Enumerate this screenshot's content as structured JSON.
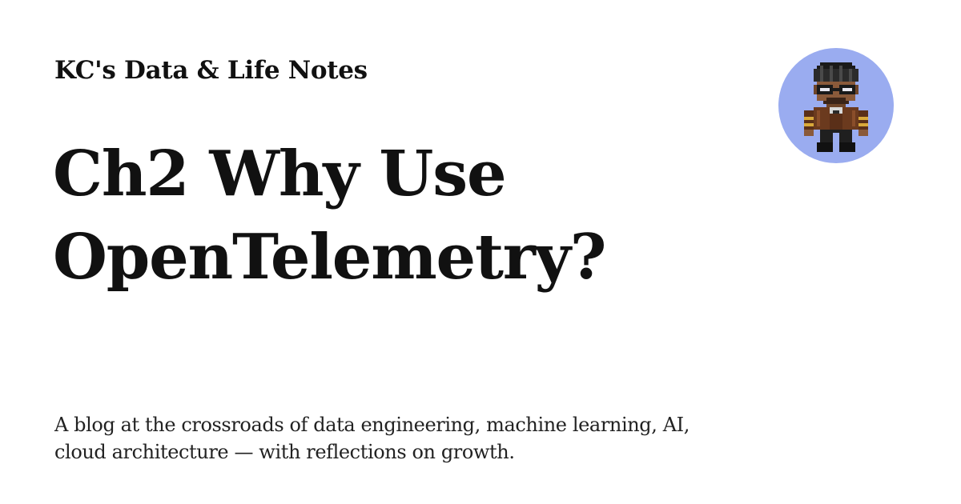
{
  "site": {
    "name": "KC's Data & Life Notes"
  },
  "post": {
    "title": "Ch2 Why Use OpenTelemetry?",
    "description": "A blog at the crossroads of data engineering, machine learning, AI, cloud architecture — with reflections on growth."
  },
  "avatar": {
    "icon": "pixel-art-character-avatar",
    "background_color": "#9aacf0"
  },
  "colors": {
    "background": "#ffffff",
    "text": "#111111"
  }
}
